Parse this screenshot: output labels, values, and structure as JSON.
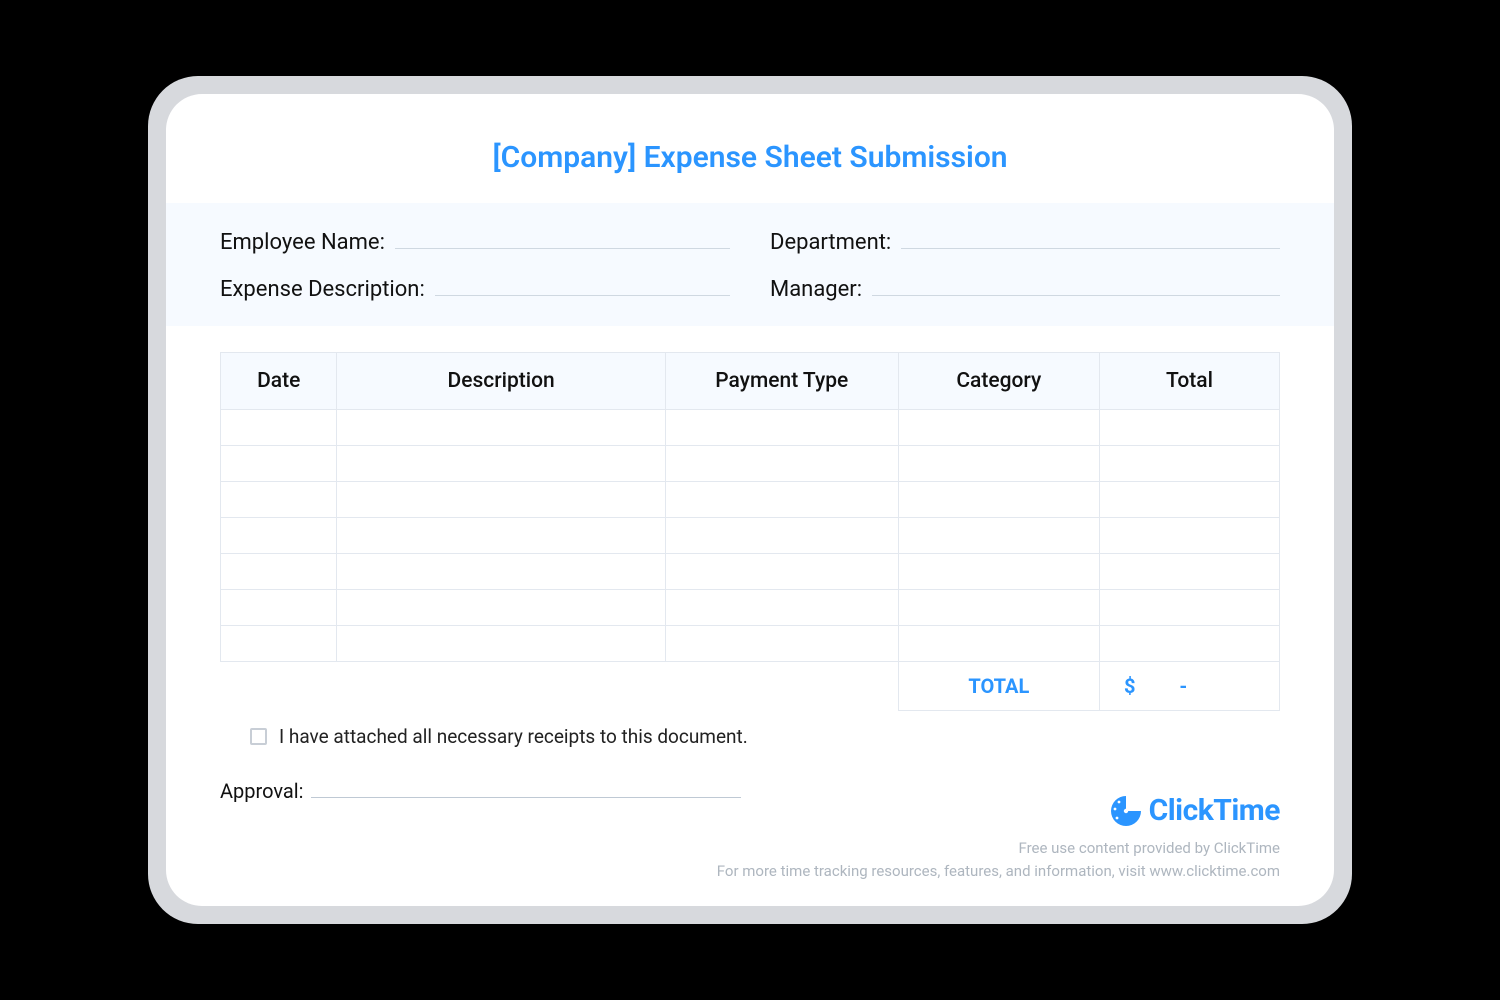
{
  "title": "[Company] Expense Sheet Submission",
  "fields": {
    "employee_name_label": "Employee Name:",
    "department_label": "Department:",
    "expense_desc_label": "Expense Description:",
    "manager_label": "Manager:"
  },
  "table": {
    "headers": {
      "date": "Date",
      "description": "Description",
      "payment": "Payment Type",
      "category": "Category",
      "total": "Total"
    },
    "total_label": "TOTAL",
    "currency": "$",
    "total_value": "-"
  },
  "checkbox_label": "I have attached all necessary receipts to this document.",
  "approval_label": "Approval:",
  "brand": "ClickTime",
  "footer": {
    "line1": "Free use content provided by ClickTime",
    "line2": "For more time tracking resources, features, and information, visit www.clicktime.com"
  }
}
